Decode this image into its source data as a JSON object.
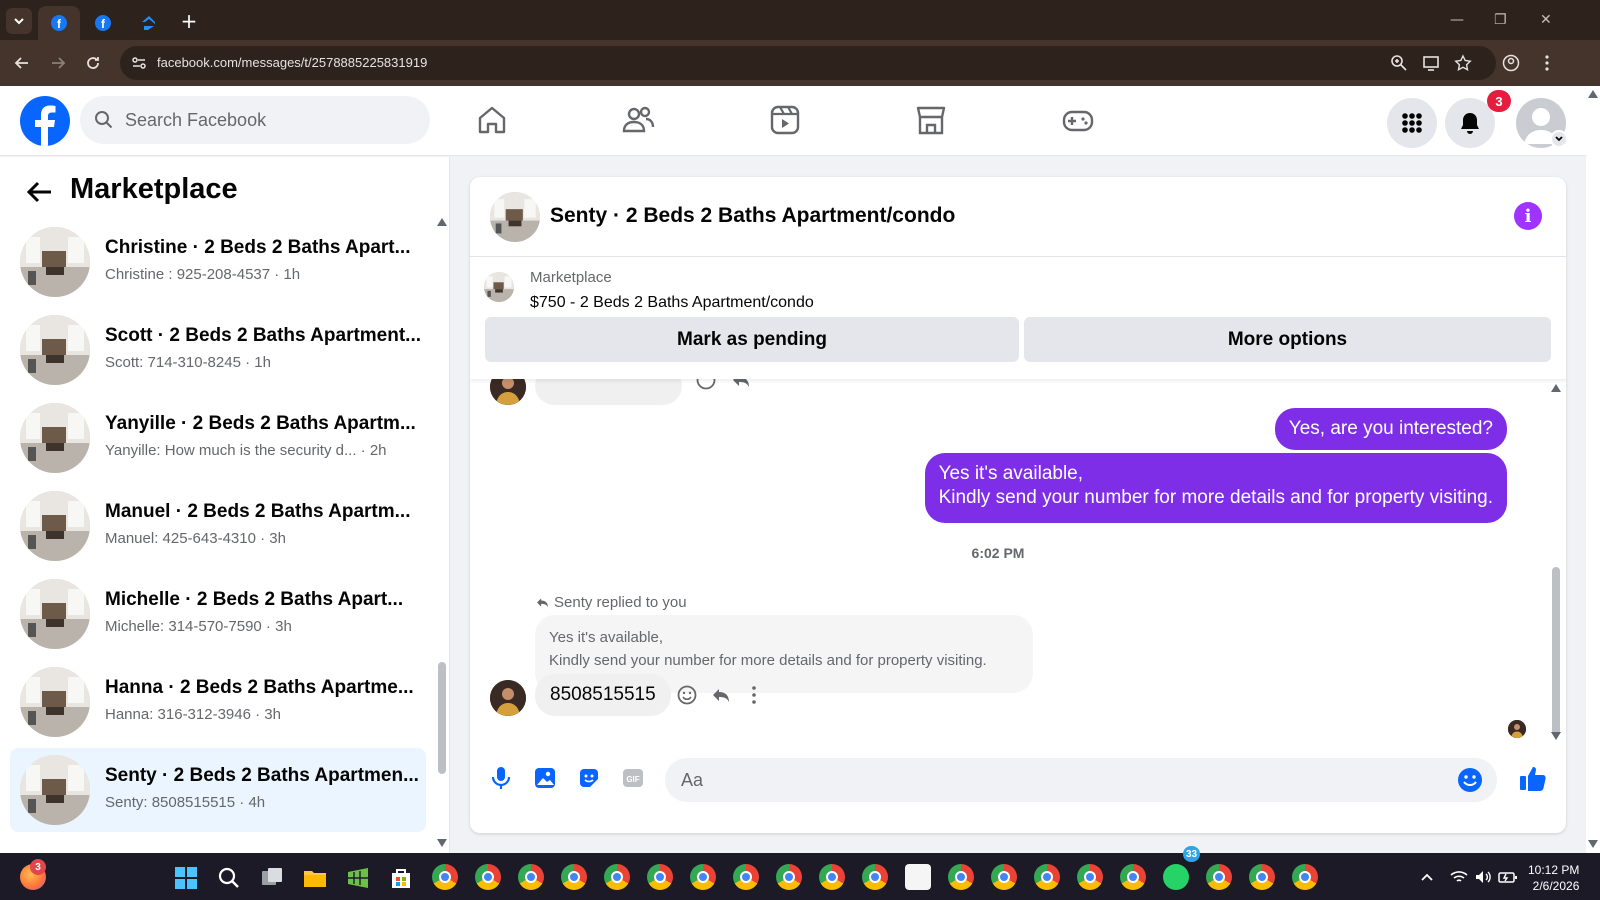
{
  "browser": {
    "url": "facebook.com/messages/t/2578885225831919",
    "tabs": [
      "facebook-tab-1",
      "facebook-tab-2",
      "zillow-tab"
    ],
    "new_tab_label": "+"
  },
  "header": {
    "search_placeholder": "Search Facebook",
    "notification_count": "3",
    "nav": [
      "home-icon",
      "friends-icon",
      "video-icon",
      "marketplace-icon",
      "gaming-icon"
    ]
  },
  "sidebar": {
    "title": "Marketplace",
    "conversations": [
      {
        "title": "Christine · 2 Beds 2 Baths Apart...",
        "subtitle": "Christine : 925-208-4537 · 1h"
      },
      {
        "title": "Scott · 2 Beds 2 Baths Apartment...",
        "subtitle": "Scott: 714-310-8245 · 1h"
      },
      {
        "title": "Yanyille · 2 Beds 2 Baths Apartm...",
        "subtitle": "Yanyille: How much is the security d... · 2h"
      },
      {
        "title": "Manuel · 2 Beds 2 Baths Apartm...",
        "subtitle": "Manuel: 425-643-4310 · 3h"
      },
      {
        "title": "Michelle · 2 Beds 2 Baths Apart...",
        "subtitle": "Michelle: 314-570-7590 · 3h"
      },
      {
        "title": "Hanna · 2 Beds 2 Baths Apartme...",
        "subtitle": "Hanna: 316-312-3946 · 3h"
      },
      {
        "title": "Senty · 2 Beds 2 Baths Apartmen...",
        "subtitle": "Senty: 8508515515 · 4h"
      }
    ],
    "selected_index": 6
  },
  "chat": {
    "title": "Senty · 2 Beds 2 Baths Apartment/condo",
    "listing_label": "Marketplace",
    "listing_price": "$750 - 2 Beds 2 Baths Apartment/condo",
    "buttons": {
      "pending": "Mark as pending",
      "more": "More options"
    },
    "messages_out": [
      "Yes, are you interested?",
      "Yes it's available,",
      "Kindly send your number for more details and for property visiting."
    ],
    "timestamp": "6:02 PM",
    "reply_label": "Senty replied to you",
    "quoted_line1": "Yes it's available,",
    "quoted_line2": "Kindly send your number for more details and for property visiting.",
    "incoming": "8508515515",
    "input_placeholder": "Aa"
  },
  "taskbar": {
    "time": "10:12 PM",
    "date": "2/6/2026",
    "whatsapp_badge": "33",
    "firefox_badge": "3"
  },
  "colors": {
    "accent": "#0866ff",
    "bubble_out": "#7f2ee8",
    "selected_row": "#ebf5ff",
    "notif_badge": "#e41e3f"
  }
}
